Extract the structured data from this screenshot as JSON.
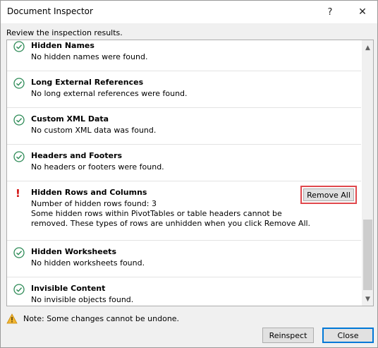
{
  "window": {
    "title": "Document Inspector",
    "help_label": "?",
    "close_label": "✕"
  },
  "subtitle": "Review the inspection results.",
  "results": [
    {
      "title": "Hidden Names",
      "description": "No hidden names were found.",
      "status": "ok"
    },
    {
      "title": "Long External References",
      "description": "No long external references were found.",
      "status": "ok"
    },
    {
      "title": "Custom XML Data",
      "description": "No custom XML data was found.",
      "status": "ok"
    },
    {
      "title": "Headers and Footers",
      "description": "No headers or footers were found.",
      "status": "ok"
    },
    {
      "title": "Hidden Rows and Columns",
      "description": "Number of hidden rows found: 3\nSome hidden rows within PivotTables or table headers cannot be\nremoved. These types of rows are unhidden when you click Remove All.",
      "status": "warning",
      "action_label": "Remove All"
    },
    {
      "title": "Hidden Worksheets",
      "description": "No hidden worksheets found.",
      "status": "ok"
    },
    {
      "title": "Invisible Content",
      "description": "No invisible objects found.",
      "status": "ok"
    }
  ],
  "warning_mark": "!",
  "note": "Note: Some changes cannot be undone.",
  "buttons": {
    "reinspect": "Reinspect",
    "close": "Close"
  },
  "colors": {
    "ok_icon": "#2e8b57",
    "warning_mark": "#d10f0f",
    "highlight_border": "#e0484d",
    "default_button_border": "#0078d7"
  },
  "icons": {
    "ok": "check-circle-icon",
    "warning": "exclamation-icon",
    "note": "warning-triangle-icon"
  }
}
